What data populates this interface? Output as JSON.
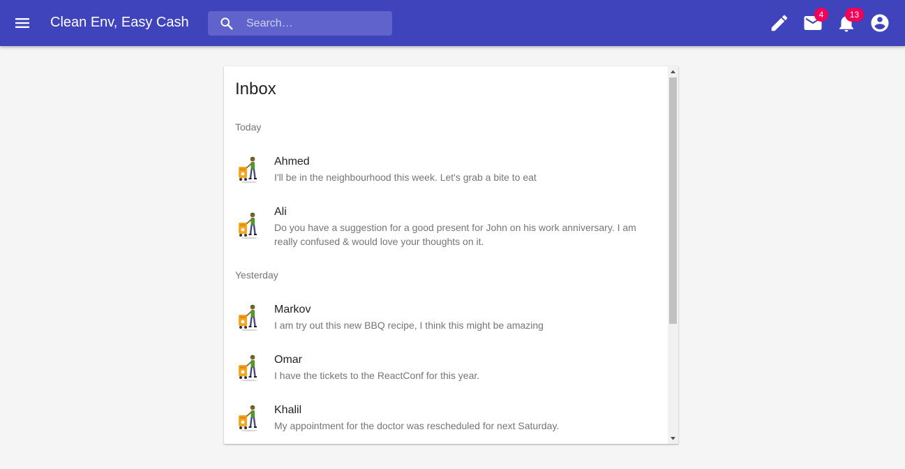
{
  "appbar": {
    "title": "Clean Env, Easy Cash",
    "search_placeholder": "Search…",
    "mail_badge": "4",
    "notifications_badge": "13",
    "icons": [
      "menu-icon",
      "search-icon",
      "edit-icon",
      "mail-icon",
      "bell-icon",
      "account-circle-icon"
    ],
    "color": "#3f44bd",
    "badge_color": "#f50057"
  },
  "inbox": {
    "title": "Inbox",
    "sections": [
      {
        "label": "Today",
        "messages": [
          {
            "name": "Ahmed",
            "text": "I'll be in the neighbourhood this week. Let's grab a bite to eat"
          },
          {
            "name": "Ali",
            "text": "Do you have a suggestion for a good present for John on his work anniversary. I am really confused & would love your thoughts on it."
          }
        ]
      },
      {
        "label": "Yesterday",
        "messages": [
          {
            "name": "Markov",
            "text": "I am try out this new BBQ recipe, I think this might be amazing"
          },
          {
            "name": "Omar",
            "text": "I have the tickets to the ReactConf for this year."
          },
          {
            "name": "Khalil",
            "text": "My appointment for the doctor was rescheduled for next Saturday."
          }
        ]
      }
    ]
  }
}
